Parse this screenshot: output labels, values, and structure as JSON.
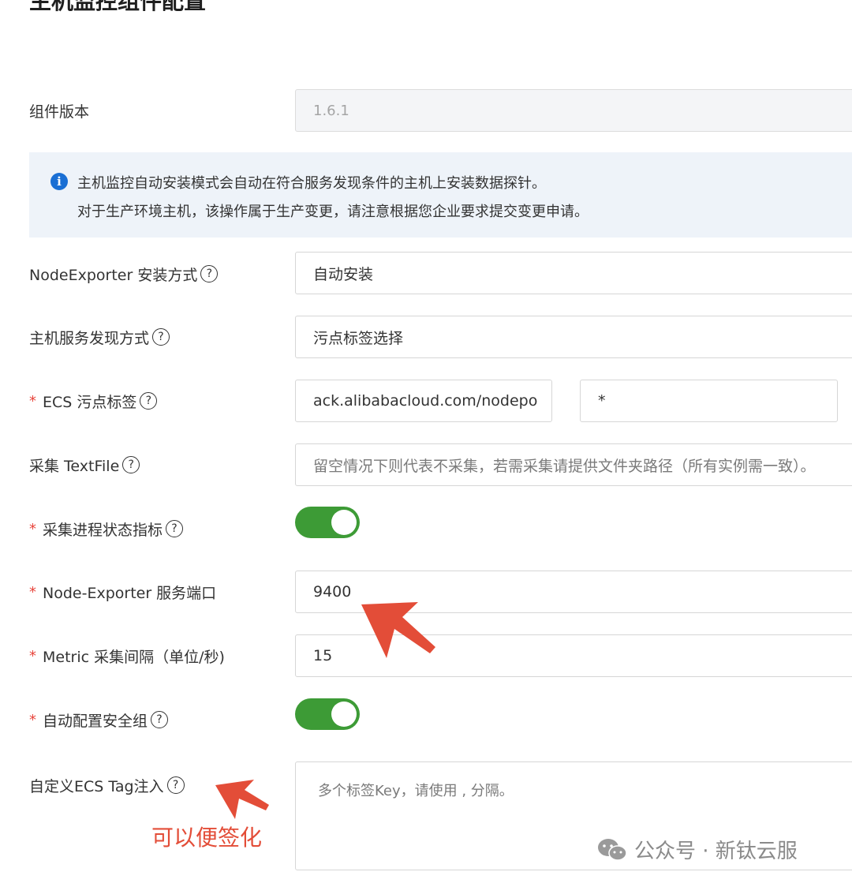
{
  "page": {
    "title": "主机监控组件配置"
  },
  "form": {
    "version": {
      "label": "组件版本",
      "value": "1.6.1"
    },
    "notice": {
      "icon": "info-icon",
      "line1": "主机监控自动安装模式会自动在符合服务发现条件的主机上安装数据探针。",
      "line2": "对于生产环境主机，该操作属于生产变更，请注意根据您企业要求提交变更申请。"
    },
    "install_mode": {
      "label": "NodeExporter 安装方式",
      "value": "自动安装"
    },
    "discovery": {
      "label": "主机服务发现方式",
      "value": "污点标签选择"
    },
    "taint": {
      "required": "*",
      "label": "ECS 污点标签",
      "key": "ack.alibabacloud.com/nodepo",
      "value": "*"
    },
    "textfile": {
      "label": "采集 TextFile",
      "placeholder": "留空情况下则代表不采集，若需采集请提供文件夹路径（所有实例需一致）。"
    },
    "process_metrics": {
      "required": "*",
      "label": "采集进程状态指标",
      "enabled": true
    },
    "port": {
      "required": "*",
      "label": "Node-Exporter 服务端口",
      "value": "9400"
    },
    "interval": {
      "required": "*",
      "label": "Metric 采集间隔（单位/秒)",
      "value": "15"
    },
    "security_group": {
      "required": "*",
      "label": "自动配置安全组",
      "enabled": true
    },
    "tag_injection": {
      "label": "自定义ECS Tag注入",
      "placeholder": "多个标签Key，请使用 , 分隔。"
    }
  },
  "annotation": {
    "text": "可以便签化",
    "color": "#e34d38"
  },
  "watermark": {
    "text": "公众号 · 新钛云服"
  },
  "colors": {
    "toggle_on": "#3d9b36",
    "info": "#1a6fd4",
    "required": "#e8453c"
  }
}
